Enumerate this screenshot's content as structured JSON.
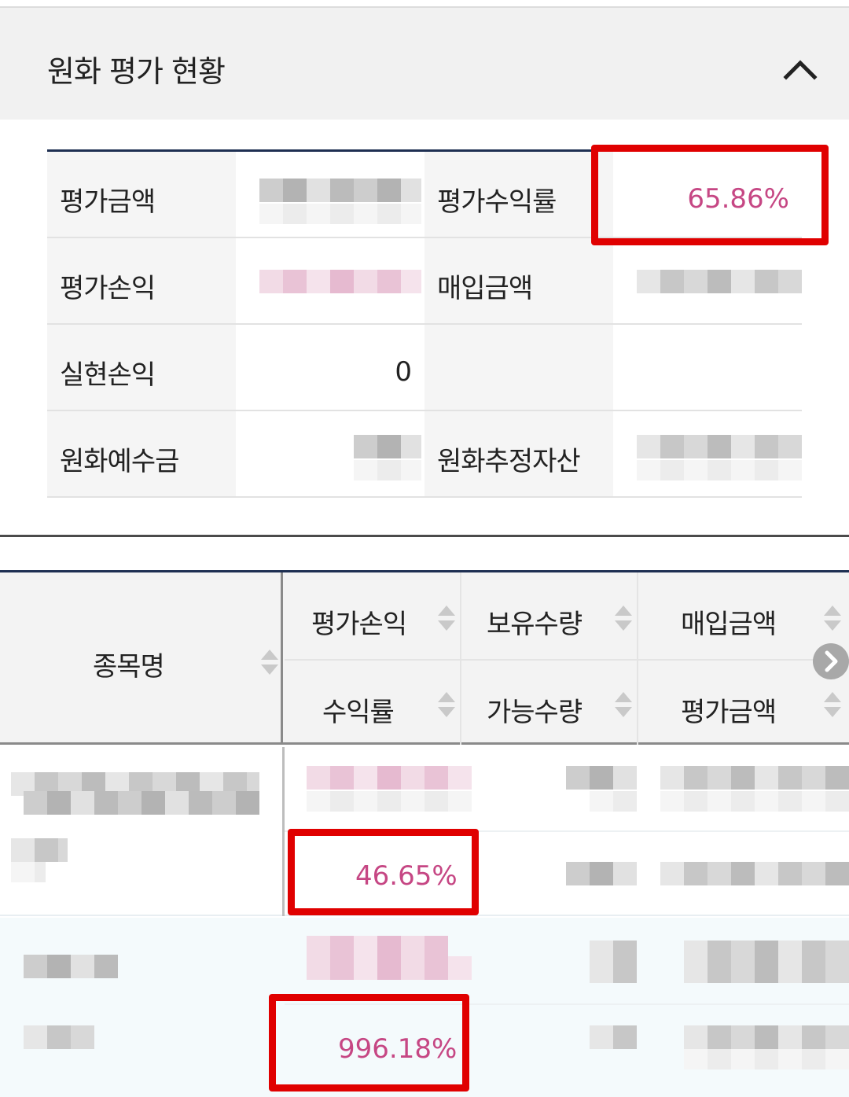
{
  "section": {
    "title": "원화 평가 현황"
  },
  "summary": {
    "eval_amount_label": "평가금액",
    "eval_return_rate_label": "평가수익률",
    "eval_return_rate_value": "65.86%",
    "eval_pnl_label": "평가손익",
    "purchase_amount_label": "매입금액",
    "realized_pnl_label": "실현손익",
    "realized_pnl_value": "0",
    "krw_deposit_label": "원화예수금",
    "krw_est_assets_label": "원화추정자산"
  },
  "holdings": {
    "headers": {
      "name": "종목명",
      "eval_pnl": "평가손익",
      "return_rate": "수익률",
      "holding_qty": "보유수량",
      "available_qty": "가능수량",
      "purchase_amount": "매입금액",
      "eval_amount": "평가금액"
    },
    "rows": [
      {
        "return_rate": "46.65%"
      },
      {
        "return_rate": "996.18%"
      }
    ]
  },
  "colors": {
    "accent_pink": "#c64784",
    "highlight_red": "#e00000",
    "header_navy": "#1e2f52"
  }
}
